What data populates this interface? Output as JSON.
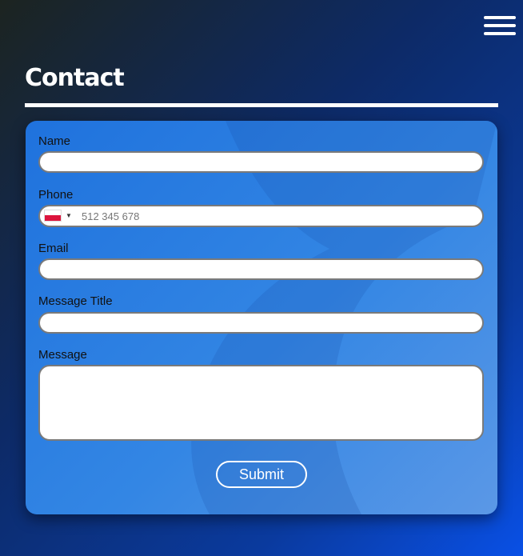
{
  "page": {
    "title": "Contact"
  },
  "menu": {
    "icon": "hamburger-menu-icon"
  },
  "form": {
    "name_label": "Name",
    "name_value": "",
    "phone_label": "Phone",
    "phone_placeholder": "512 345 678",
    "phone_country_flag": "poland-flag-icon",
    "email_label": "Email",
    "email_value": "",
    "message_title_label": "Message Title",
    "message_title_value": "",
    "message_label": "Message",
    "message_value": "",
    "submit_label": "Submit"
  },
  "colors": {
    "card": "#2f7fe0",
    "text": "#111111",
    "flag_white": "#ffffff",
    "flag_red": "#dc143c"
  }
}
